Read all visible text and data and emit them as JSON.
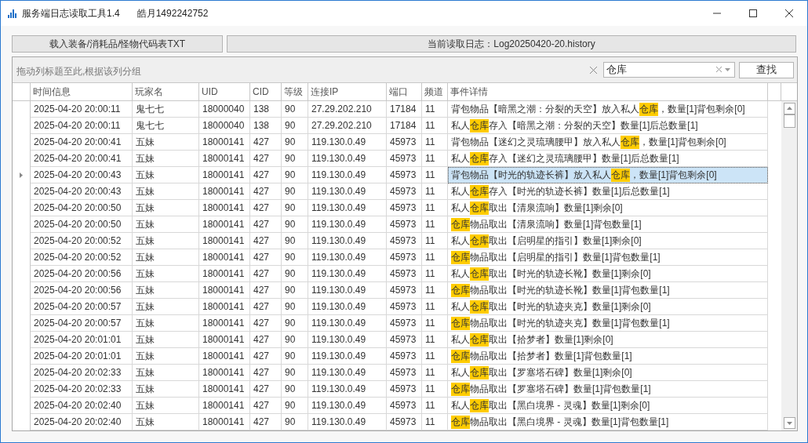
{
  "window": {
    "title": "服务端日志读取工具1.4",
    "subtitle": "皓月1492242752"
  },
  "toolbar": {
    "load_button": "载入装备/消耗品/怪物代码表TXT",
    "current_log": "当前读取日志：Log20250420-20.history"
  },
  "group_panel": {
    "hint": "拖动列标题至此,根据该列分组",
    "search_value": "仓库",
    "find_button": "查找"
  },
  "table": {
    "columns": [
      "时间信息",
      "玩家名",
      "UID",
      "CID",
      "等级",
      "连接IP",
      "端口",
      "频道",
      "事件详情"
    ],
    "rows": [
      {
        "selected": false,
        "cells": [
          "2025-04-20 20:00:11",
          "鬼七七",
          "18000040",
          "138",
          "90",
          "27.29.202.210",
          "17184",
          "11"
        ],
        "event": [
          {
            "text": "背包物品【暗黑之潮：分裂的天空】放入私人",
            "highlight": false
          },
          {
            "text": "仓库",
            "highlight": true
          },
          {
            "text": "，数量[1]背包剩余[0]",
            "highlight": false
          }
        ]
      },
      {
        "selected": false,
        "cells": [
          "2025-04-20 20:00:11",
          "鬼七七",
          "18000040",
          "138",
          "90",
          "27.29.202.210",
          "17184",
          "11"
        ],
        "event": [
          {
            "text": "私人",
            "highlight": false
          },
          {
            "text": "仓库",
            "highlight": true
          },
          {
            "text": "存入【暗黑之潮：分裂的天空】数量[1]后总数量[1]",
            "highlight": false
          }
        ]
      },
      {
        "selected": false,
        "cells": [
          "2025-04-20 20:00:41",
          "五妹",
          "18000141",
          "427",
          "90",
          "119.130.0.49",
          "45973",
          "11"
        ],
        "event": [
          {
            "text": "背包物品【迷幻之灵琉璃腰甲】放入私人",
            "highlight": false
          },
          {
            "text": "仓库",
            "highlight": true
          },
          {
            "text": "，数量[1]背包剩余[0]",
            "highlight": false
          }
        ]
      },
      {
        "selected": false,
        "cells": [
          "2025-04-20 20:00:41",
          "五妹",
          "18000141",
          "427",
          "90",
          "119.130.0.49",
          "45973",
          "11"
        ],
        "event": [
          {
            "text": "私人",
            "highlight": false
          },
          {
            "text": "仓库",
            "highlight": true
          },
          {
            "text": "存入【迷幻之灵琉璃腰甲】数量[1]后总数量[1]",
            "highlight": false
          }
        ]
      },
      {
        "selected": true,
        "cells": [
          "2025-04-20 20:00:43",
          "五妹",
          "18000141",
          "427",
          "90",
          "119.130.0.49",
          "45973",
          "11"
        ],
        "event": [
          {
            "text": "背包物品【时光的轨迹长裤】放入私人",
            "highlight": false
          },
          {
            "text": "仓库",
            "highlight": true
          },
          {
            "text": "，数量[1]背包剩余[0]",
            "highlight": false
          }
        ]
      },
      {
        "selected": false,
        "cells": [
          "2025-04-20 20:00:43",
          "五妹",
          "18000141",
          "427",
          "90",
          "119.130.0.49",
          "45973",
          "11"
        ],
        "event": [
          {
            "text": "私人",
            "highlight": false
          },
          {
            "text": "仓库",
            "highlight": true
          },
          {
            "text": "存入【时光的轨迹长裤】数量[1]后总数量[1]",
            "highlight": false
          }
        ]
      },
      {
        "selected": false,
        "cells": [
          "2025-04-20 20:00:50",
          "五妹",
          "18000141",
          "427",
          "90",
          "119.130.0.49",
          "45973",
          "11"
        ],
        "event": [
          {
            "text": "私人",
            "highlight": false
          },
          {
            "text": "仓库",
            "highlight": true
          },
          {
            "text": "取出【清泉流响】数量[1]剩余[0]",
            "highlight": false
          }
        ]
      },
      {
        "selected": false,
        "cells": [
          "2025-04-20 20:00:50",
          "五妹",
          "18000141",
          "427",
          "90",
          "119.130.0.49",
          "45973",
          "11"
        ],
        "event": [
          {
            "text": "仓库",
            "highlight": true
          },
          {
            "text": "物品取出【清泉流响】数量[1]背包数量[1]",
            "highlight": false
          }
        ]
      },
      {
        "selected": false,
        "cells": [
          "2025-04-20 20:00:52",
          "五妹",
          "18000141",
          "427",
          "90",
          "119.130.0.49",
          "45973",
          "11"
        ],
        "event": [
          {
            "text": "私人",
            "highlight": false
          },
          {
            "text": "仓库",
            "highlight": true
          },
          {
            "text": "取出【启明星的指引】数量[1]剩余[0]",
            "highlight": false
          }
        ]
      },
      {
        "selected": false,
        "cells": [
          "2025-04-20 20:00:52",
          "五妹",
          "18000141",
          "427",
          "90",
          "119.130.0.49",
          "45973",
          "11"
        ],
        "event": [
          {
            "text": "仓库",
            "highlight": true
          },
          {
            "text": "物品取出【启明星的指引】数量[1]背包数量[1]",
            "highlight": false
          }
        ]
      },
      {
        "selected": false,
        "cells": [
          "2025-04-20 20:00:56",
          "五妹",
          "18000141",
          "427",
          "90",
          "119.130.0.49",
          "45973",
          "11"
        ],
        "event": [
          {
            "text": "私人",
            "highlight": false
          },
          {
            "text": "仓库",
            "highlight": true
          },
          {
            "text": "取出【时光的轨迹长靴】数量[1]剩余[0]",
            "highlight": false
          }
        ]
      },
      {
        "selected": false,
        "cells": [
          "2025-04-20 20:00:56",
          "五妹",
          "18000141",
          "427",
          "90",
          "119.130.0.49",
          "45973",
          "11"
        ],
        "event": [
          {
            "text": "仓库",
            "highlight": true
          },
          {
            "text": "物品取出【时光的轨迹长靴】数量[1]背包数量[1]",
            "highlight": false
          }
        ]
      },
      {
        "selected": false,
        "cells": [
          "2025-04-20 20:00:57",
          "五妹",
          "18000141",
          "427",
          "90",
          "119.130.0.49",
          "45973",
          "11"
        ],
        "event": [
          {
            "text": "私人",
            "highlight": false
          },
          {
            "text": "仓库",
            "highlight": true
          },
          {
            "text": "取出【时光的轨迹夹克】数量[1]剩余[0]",
            "highlight": false
          }
        ]
      },
      {
        "selected": false,
        "cells": [
          "2025-04-20 20:00:57",
          "五妹",
          "18000141",
          "427",
          "90",
          "119.130.0.49",
          "45973",
          "11"
        ],
        "event": [
          {
            "text": "仓库",
            "highlight": true
          },
          {
            "text": "物品取出【时光的轨迹夹克】数量[1]背包数量[1]",
            "highlight": false
          }
        ]
      },
      {
        "selected": false,
        "cells": [
          "2025-04-20 20:01:01",
          "五妹",
          "18000141",
          "427",
          "90",
          "119.130.0.49",
          "45973",
          "11"
        ],
        "event": [
          {
            "text": "私人",
            "highlight": false
          },
          {
            "text": "仓库",
            "highlight": true
          },
          {
            "text": "取出【拾梦者】数量[1]剩余[0]",
            "highlight": false
          }
        ]
      },
      {
        "selected": false,
        "cells": [
          "2025-04-20 20:01:01",
          "五妹",
          "18000141",
          "427",
          "90",
          "119.130.0.49",
          "45973",
          "11"
        ],
        "event": [
          {
            "text": "仓库",
            "highlight": true
          },
          {
            "text": "物品取出【拾梦者】数量[1]背包数量[1]",
            "highlight": false
          }
        ]
      },
      {
        "selected": false,
        "cells": [
          "2025-04-20 20:02:33",
          "五妹",
          "18000141",
          "427",
          "90",
          "119.130.0.49",
          "45973",
          "11"
        ],
        "event": [
          {
            "text": "私人",
            "highlight": false
          },
          {
            "text": "仓库",
            "highlight": true
          },
          {
            "text": "取出【罗塞塔石碑】数量[1]剩余[0]",
            "highlight": false
          }
        ]
      },
      {
        "selected": false,
        "cells": [
          "2025-04-20 20:02:33",
          "五妹",
          "18000141",
          "427",
          "90",
          "119.130.0.49",
          "45973",
          "11"
        ],
        "event": [
          {
            "text": "仓库",
            "highlight": true
          },
          {
            "text": "物品取出【罗塞塔石碑】数量[1]背包数量[1]",
            "highlight": false
          }
        ]
      },
      {
        "selected": false,
        "cells": [
          "2025-04-20 20:02:40",
          "五妹",
          "18000141",
          "427",
          "90",
          "119.130.0.49",
          "45973",
          "11"
        ],
        "event": [
          {
            "text": "私人",
            "highlight": false
          },
          {
            "text": "仓库",
            "highlight": true
          },
          {
            "text": "取出【黑白境界 - 灵魂】数量[1]剩余[0]",
            "highlight": false
          }
        ]
      },
      {
        "selected": false,
        "cells": [
          "2025-04-20 20:02:40",
          "五妹",
          "18000141",
          "427",
          "90",
          "119.130.0.49",
          "45973",
          "11"
        ],
        "event": [
          {
            "text": "仓库",
            "highlight": true
          },
          {
            "text": "物品取出【黑白境界 - 灵魂】数量[1]背包数量[1]",
            "highlight": false
          }
        ]
      }
    ]
  }
}
